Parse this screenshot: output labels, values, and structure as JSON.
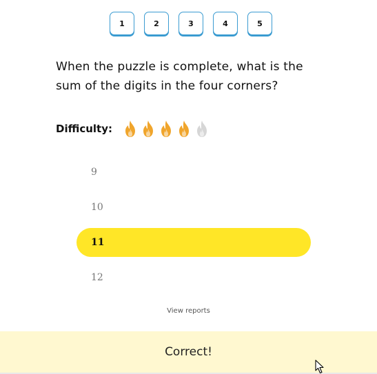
{
  "pager": {
    "pages": [
      "1",
      "2",
      "3",
      "4",
      "5"
    ]
  },
  "question": {
    "text": "When the puzzle is complete, what is the sum of the digits in the four corners?"
  },
  "difficulty": {
    "label": "Difficulty:",
    "level": 4,
    "max": 5,
    "active_color": "#f0a52c",
    "inactive_color": "#d6d6d6",
    "icon": "flame-icon"
  },
  "answers": {
    "options": [
      "9",
      "10",
      "11",
      "12"
    ],
    "selected": "11",
    "selected_color": "#ffe627"
  },
  "reports": {
    "label": "View reports"
  },
  "result": {
    "text": "Correct!",
    "background": "#fff8d0"
  }
}
